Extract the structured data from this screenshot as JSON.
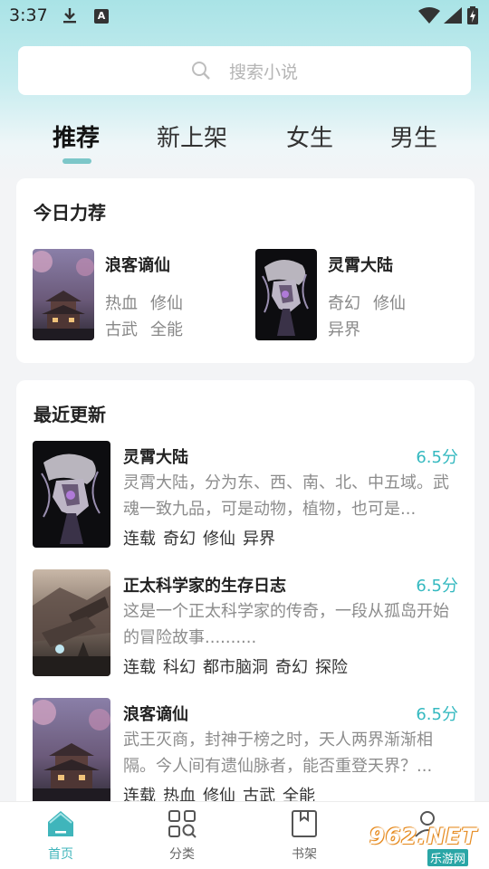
{
  "status_bar": {
    "time": "3:37"
  },
  "search": {
    "placeholder": "搜索小说"
  },
  "tabs": [
    {
      "label": "推荐",
      "active": true
    },
    {
      "label": "新上架",
      "active": false
    },
    {
      "label": "女生",
      "active": false
    },
    {
      "label": "男生",
      "active": false
    }
  ],
  "today": {
    "title": "今日力荐",
    "picks": [
      {
        "title": "浪客谪仙",
        "tags": [
          "热血",
          "修仙",
          "古武",
          "全能"
        ]
      },
      {
        "title": "灵霄大陆",
        "tags": [
          "奇幻",
          "修仙",
          "异界"
        ]
      }
    ]
  },
  "recent": {
    "title": "最近更新",
    "books": [
      {
        "title": "灵霄大陆",
        "score": "6.5分",
        "desc": "灵霄大陆，分为东、西、南、北、中五域。武魂一致九品，可是动物，植物，也可是...",
        "tags": [
          "连载",
          "奇幻",
          "修仙",
          "异界"
        ]
      },
      {
        "title": "正太科学家的生存日志",
        "score": "6.5分",
        "desc": "这是一个正太科学家的传奇，一段从孤岛开始的冒险故事..........",
        "tags": [
          "连载",
          "科幻",
          "都市脑洞",
          "奇幻",
          "探险"
        ]
      },
      {
        "title": "浪客谪仙",
        "score": "6.5分",
        "desc": "武王灭商，封神于榜之时，天人两界渐渐相隔。今人间有遗仙脉者，能否重登天界？...",
        "tags": [
          "连载",
          "热血",
          "修仙",
          "古武",
          "全能"
        ]
      }
    ]
  },
  "nav": [
    {
      "label": "首页",
      "icon": "home-icon",
      "active": true
    },
    {
      "label": "分类",
      "icon": "category-icon",
      "active": false
    },
    {
      "label": "书架",
      "icon": "bookshelf-icon",
      "active": false
    },
    {
      "label": "",
      "icon": "profile-icon",
      "active": false
    }
  ],
  "watermark": {
    "text": "962.NET",
    "sub": "乐游网"
  },
  "colors": {
    "accent": "#3fb5bb",
    "score": "#35b9c0",
    "indicator": "#7cc7c9"
  }
}
